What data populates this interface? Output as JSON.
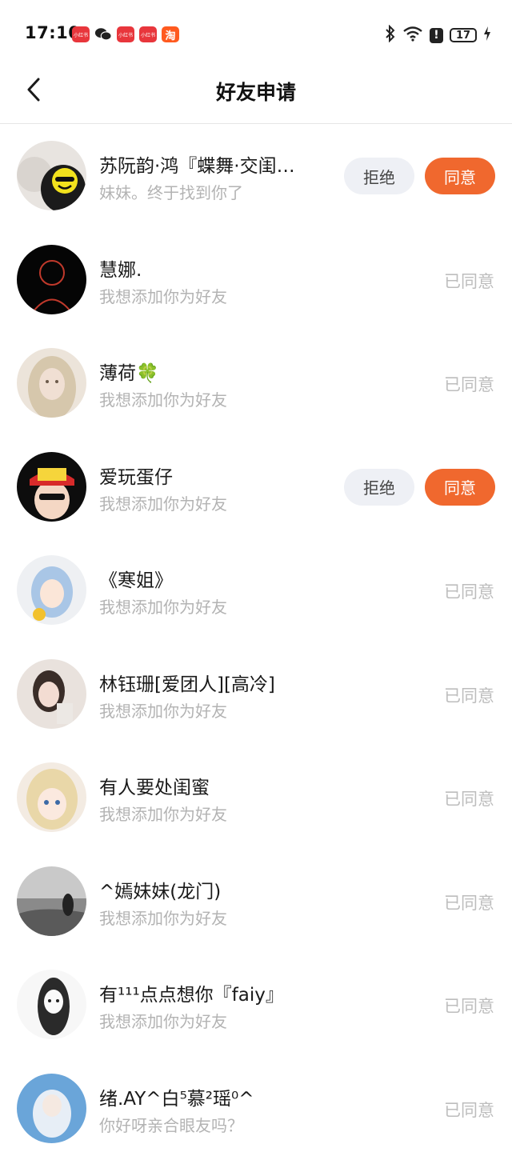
{
  "status_bar": {
    "time": "17:10",
    "battery": "17",
    "apps": [
      {
        "icon": "xiaohongshu-icon",
        "label": "小红书"
      },
      {
        "icon": "wechat-icon",
        "label": ""
      },
      {
        "icon": "xiaohongshu-icon",
        "label": "小红书"
      },
      {
        "icon": "xiaohongshu-icon",
        "label": "小红书"
      },
      {
        "icon": "taobao-icon",
        "label": "淘"
      }
    ],
    "alert_mark": "!"
  },
  "header": {
    "title": "好友申请",
    "back_icon": "chevron-left-icon"
  },
  "colors": {
    "accent": "#f0682e",
    "reject_bg": "#eef0f5",
    "muted_text": "#b3b3b3"
  },
  "requests": [
    {
      "name": "苏阮韵·鸿『蝶舞·交闺…",
      "message": "妹妹。终于找到你了",
      "state": "pending",
      "reject_label": "拒绝",
      "agree_label": "同意",
      "status_label": ""
    },
    {
      "name": "慧娜.",
      "message": "我想添加你为好友",
      "state": "accepted",
      "reject_label": "",
      "agree_label": "",
      "status_label": "已同意"
    },
    {
      "name": "薄荷🍀",
      "message": "我想添加你为好友",
      "state": "accepted",
      "reject_label": "",
      "agree_label": "",
      "status_label": "已同意"
    },
    {
      "name": "爱玩蛋仔",
      "message": "我想添加你为好友",
      "state": "pending",
      "reject_label": "拒绝",
      "agree_label": "同意",
      "status_label": ""
    },
    {
      "name": "《寒姐》",
      "message": "我想添加你为好友",
      "state": "accepted",
      "reject_label": "",
      "agree_label": "",
      "status_label": "已同意"
    },
    {
      "name": "林钰珊[爱团人][高冷]",
      "message": "我想添加你为好友",
      "state": "accepted",
      "reject_label": "",
      "agree_label": "",
      "status_label": "已同意"
    },
    {
      "name": "有人要处闺蜜",
      "message": "我想添加你为好友",
      "state": "accepted",
      "reject_label": "",
      "agree_label": "",
      "status_label": "已同意"
    },
    {
      "name": "^嫣妹妹(龙门)",
      "message": "我想添加你为好友",
      "state": "accepted",
      "reject_label": "",
      "agree_label": "",
      "status_label": "已同意"
    },
    {
      "name": "有¹¹¹点点想你『faiy』",
      "message": "我想添加你为好友",
      "state": "accepted",
      "reject_label": "",
      "agree_label": "",
      "status_label": "已同意"
    },
    {
      "name": "绪.AY^白⁵慕²瑶⁰^",
      "message": "你好呀亲合眼友吗？",
      "state": "accepted",
      "reject_label": "",
      "agree_label": "",
      "status_label": "已同意"
    }
  ]
}
